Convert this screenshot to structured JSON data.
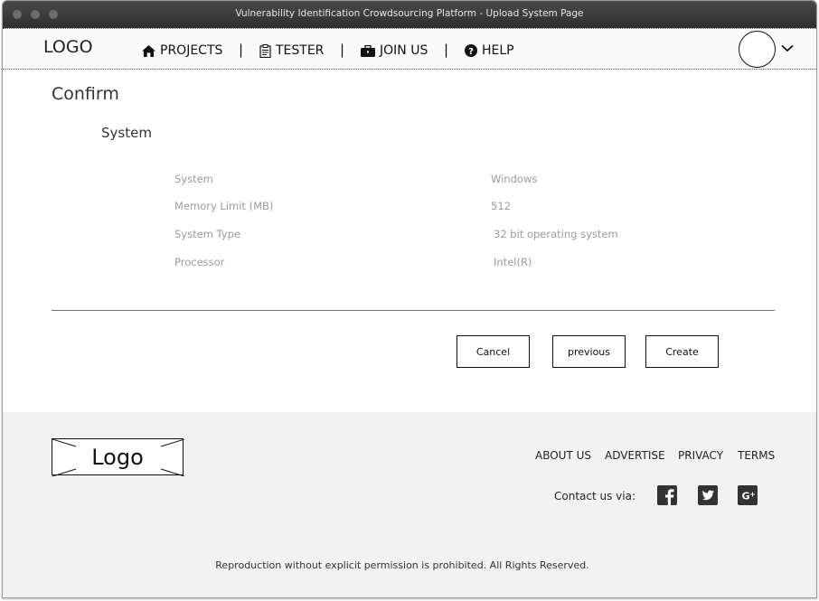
{
  "window": {
    "title": "Vulnerability Identification Crowdsourcing Platform  - Upload System Page"
  },
  "header": {
    "logo": "LOGO",
    "nav": [
      {
        "label": "PROJECTS",
        "icon": "home-icon"
      },
      {
        "label": "TESTER",
        "icon": "clipboard-icon"
      },
      {
        "label": "JOIN US",
        "icon": "briefcase-icon"
      },
      {
        "label": "HELP",
        "icon": "question-circle-icon"
      }
    ],
    "separator": "|",
    "user_menu_icon": "chevron-down-icon"
  },
  "main": {
    "title": "Confirm",
    "section_title": "System",
    "rows": [
      {
        "label": "System",
        "value": "Windows"
      },
      {
        "label": "Memory Limit (MB)",
        "value": "512"
      },
      {
        "label": "System Type",
        "value": "32 bit operating system"
      },
      {
        "label": "Processor",
        "value": "Intel(R)"
      }
    ],
    "buttons": {
      "cancel": "Cancel",
      "previous": "previous",
      "create": "Create"
    }
  },
  "footer": {
    "logo": "Logo",
    "links": [
      "ABOUT US",
      "ADVERTISE",
      "PRIVACY",
      "TERMS"
    ],
    "contact_label": "Contact us via:",
    "social": [
      "facebook-icon",
      "twitter-icon",
      "google-plus-icon"
    ],
    "copyright": "Reproduction without explicit permission is prohibited. All Rights Reserved."
  },
  "colors": {
    "title_bar": "#2e2e2e",
    "muted_text": "#9b9b9b",
    "footer_bg": "#f2f2f2"
  }
}
